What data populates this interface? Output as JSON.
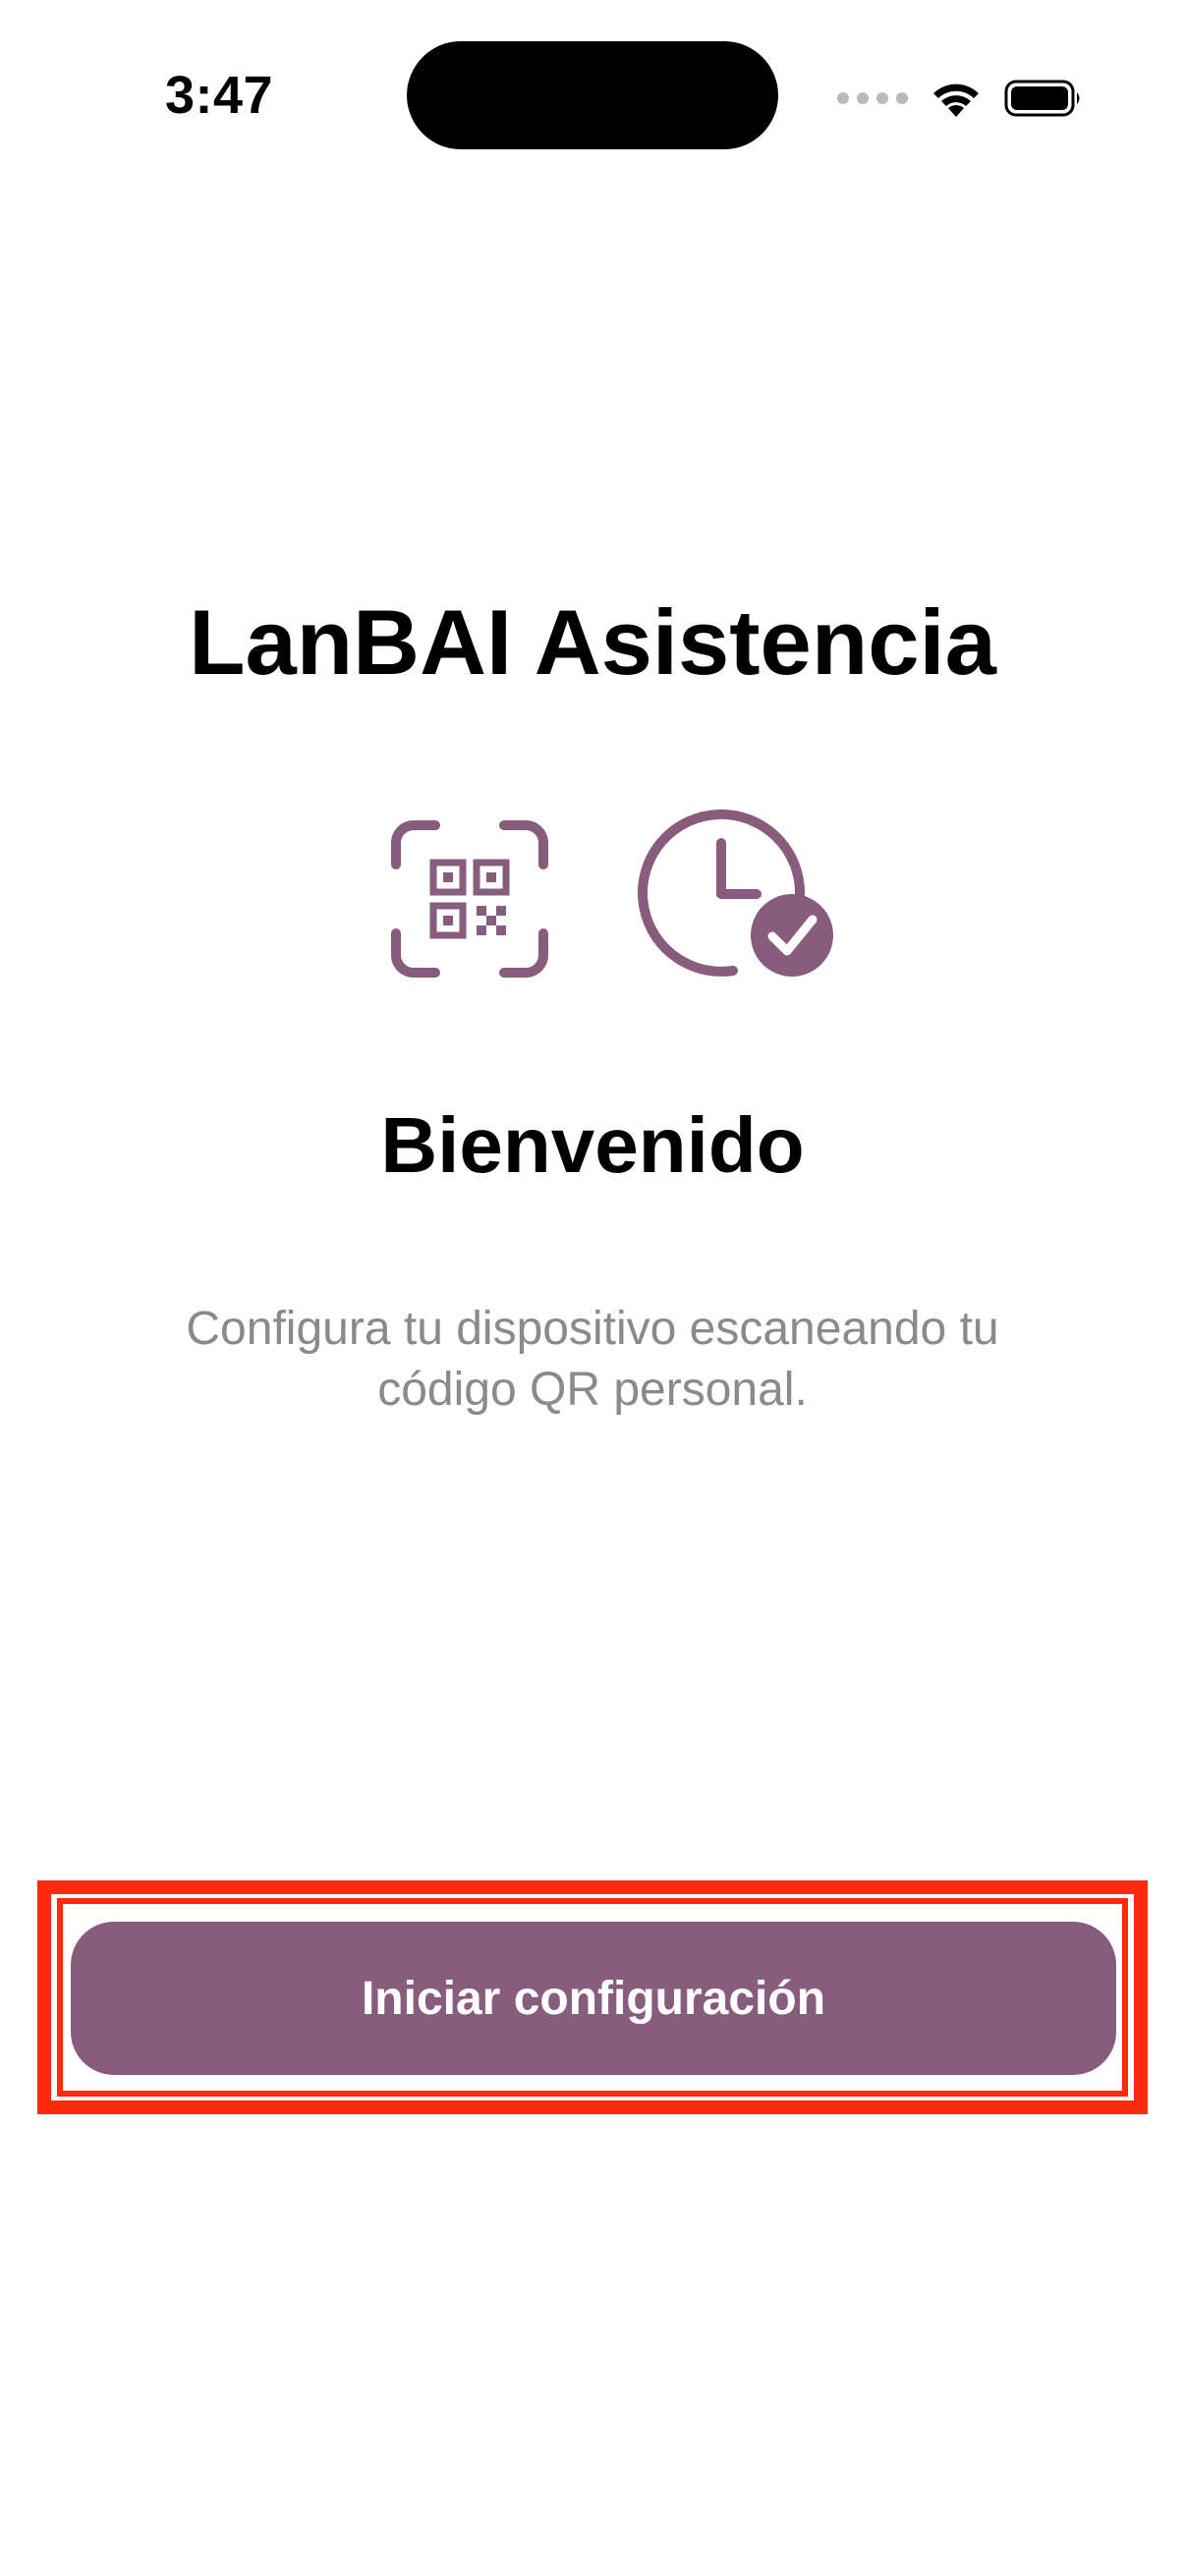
{
  "status_bar": {
    "time": "3:47",
    "icons": [
      "signal-dots-icon",
      "wifi-icon",
      "battery-icon"
    ]
  },
  "main": {
    "app_title": "LanBAI Asistencia",
    "icons": [
      "qr-scan-icon",
      "clock-check-icon"
    ],
    "welcome": "Bienvenido",
    "subtitle_line1": "Configura tu dispositivo escaneando tu",
    "subtitle_line2": "código QR personal.",
    "start_button_label": "Iniciar configuración"
  },
  "colors": {
    "accent": "#875c7d",
    "highlight": "#ff2a0d",
    "subtitle": "#8a8a8e"
  }
}
